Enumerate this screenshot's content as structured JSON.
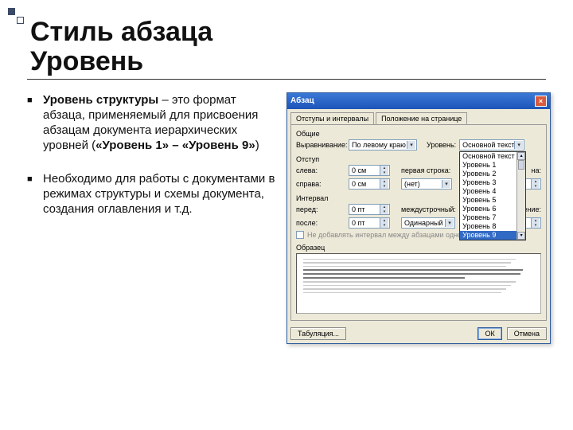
{
  "slide": {
    "title_l1": "Стиль абзаца",
    "title_l2": "Уровень",
    "bullets": [
      {
        "strong": "Уровень структуры",
        "rest": " – это формат абзаца, применяемый для присвоения абзацам документа иерархических уровней (",
        "strong2": "«Уровень 1» – «Уровень 9»",
        "tail": ")"
      },
      {
        "body": "Необходимо для работы с документами в режимах структуры и схемы документа, создания оглавления и т.д."
      }
    ]
  },
  "dialog": {
    "title": "Абзац",
    "close": "×",
    "tab1": "Отступы и интервалы",
    "tab2": "Положение на странице",
    "sec_general": "Общие",
    "align_label": "Выравнивание:",
    "align_value": "По левому краю",
    "level_label": "Уровень:",
    "level_value": "Основной текст",
    "level_options": [
      "Основной текст",
      "Уровень 1",
      "Уровень 2",
      "Уровень 3",
      "Уровень 4",
      "Уровень 5",
      "Уровень 6",
      "Уровень 7",
      "Уровень 8",
      "Уровень 9"
    ],
    "sec_indent": "Отступ",
    "left_label": "слева:",
    "left_value": "0 см",
    "right_label": "справа:",
    "right_value": "0 см",
    "first_label": "первая строка:",
    "first_value": "(нет)",
    "on_label": "на:",
    "sec_interval": "Интервал",
    "before_label": "перед:",
    "before_value": "0 пт",
    "after_label": "после:",
    "after_value": "0 пт",
    "line_label": "междустрочный:",
    "line_value": "Одинарный",
    "value_label": "значение:",
    "nospace_label": "Не добавлять интервал между абзацами одного стиля",
    "sec_sample": "Образец",
    "btn_tabs": "Табуляция...",
    "btn_ok": "ОК",
    "btn_cancel": "Отмена"
  }
}
